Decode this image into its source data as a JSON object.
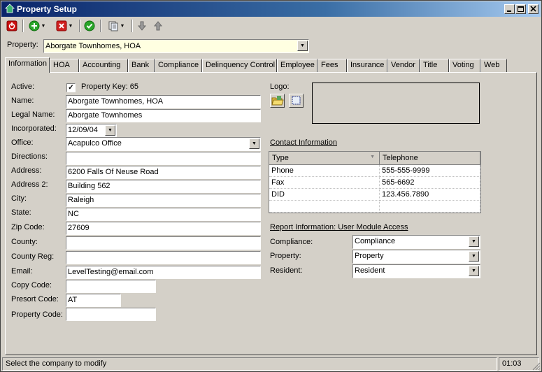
{
  "window": {
    "title": "Property Setup",
    "titlebar_color": "#0a246a"
  },
  "toolbar": {
    "icons": [
      "power-icon",
      "add-icon",
      "delete-icon",
      "save-check-icon",
      "copy-icon",
      "arrow-down-icon",
      "arrow-up-icon"
    ]
  },
  "property_selector": {
    "label": "Property:",
    "value": "Aborgate Townhomes, HOA"
  },
  "tabs": [
    {
      "label": "Information",
      "active": true
    },
    {
      "label": "HOA"
    },
    {
      "label": "Accounting"
    },
    {
      "label": "Bank"
    },
    {
      "label": "Compliance"
    },
    {
      "label": "Delinquency Control"
    },
    {
      "label": "Employee"
    },
    {
      "label": "Fees"
    },
    {
      "label": "Insurance"
    },
    {
      "label": "Vendor"
    },
    {
      "label": "Title"
    },
    {
      "label": "Voting"
    },
    {
      "label": "Web"
    }
  ],
  "form": {
    "active_label": "Active:",
    "active_checked": true,
    "property_key_label": "Property Key: 65",
    "name_label": "Name:",
    "name_value": "Aborgate Townhomes, HOA",
    "legal_name_label": "Legal Name:",
    "legal_name_value": "Aborgate Townhomes",
    "incorporated_label": "Incorporated:",
    "incorporated_value": "12/09/04",
    "office_label": "Office:",
    "office_value": "Acapulco Office",
    "directions_label": "Directions:",
    "directions_value": "",
    "address_label": "Address:",
    "address_value": "6200 Falls Of Neuse Road",
    "address2_label": "Address 2:",
    "address2_value": "Building 562",
    "city_label": "City:",
    "city_value": "Raleigh",
    "state_label": "State:",
    "state_value": "NC",
    "zip_label": "Zip Code:",
    "zip_value": "27609",
    "county_label": "County:",
    "county_value": "",
    "county_reg_label": "County Reg:",
    "county_reg_value": "",
    "email_label": "Email:",
    "email_value": "LevelTesting@email.com",
    "copy_code_label": "Copy Code:",
    "copy_code_value": "",
    "presort_code_label": "Presort Code:",
    "presort_code_value": "AT",
    "property_code_label": "Property Code:",
    "property_code_value": ""
  },
  "logo": {
    "label": "Logo:"
  },
  "contact": {
    "heading": "Contact Information",
    "columns": [
      "Type",
      "Telephone"
    ],
    "rows": [
      {
        "type": "Phone",
        "telephone": "555-555-9999"
      },
      {
        "type": "Fax",
        "telephone": "565-6692"
      },
      {
        "type": "DID",
        "telephone": "123.456.7890"
      }
    ]
  },
  "report": {
    "heading": "Report Information: User Module Access",
    "compliance_label": "Compliance:",
    "compliance_value": "Compliance",
    "property_label": "Property:",
    "property_value": "Property",
    "resident_label": "Resident:",
    "resident_value": "Resident"
  },
  "status": {
    "message": "Select the company to modify",
    "time": "01:03"
  }
}
